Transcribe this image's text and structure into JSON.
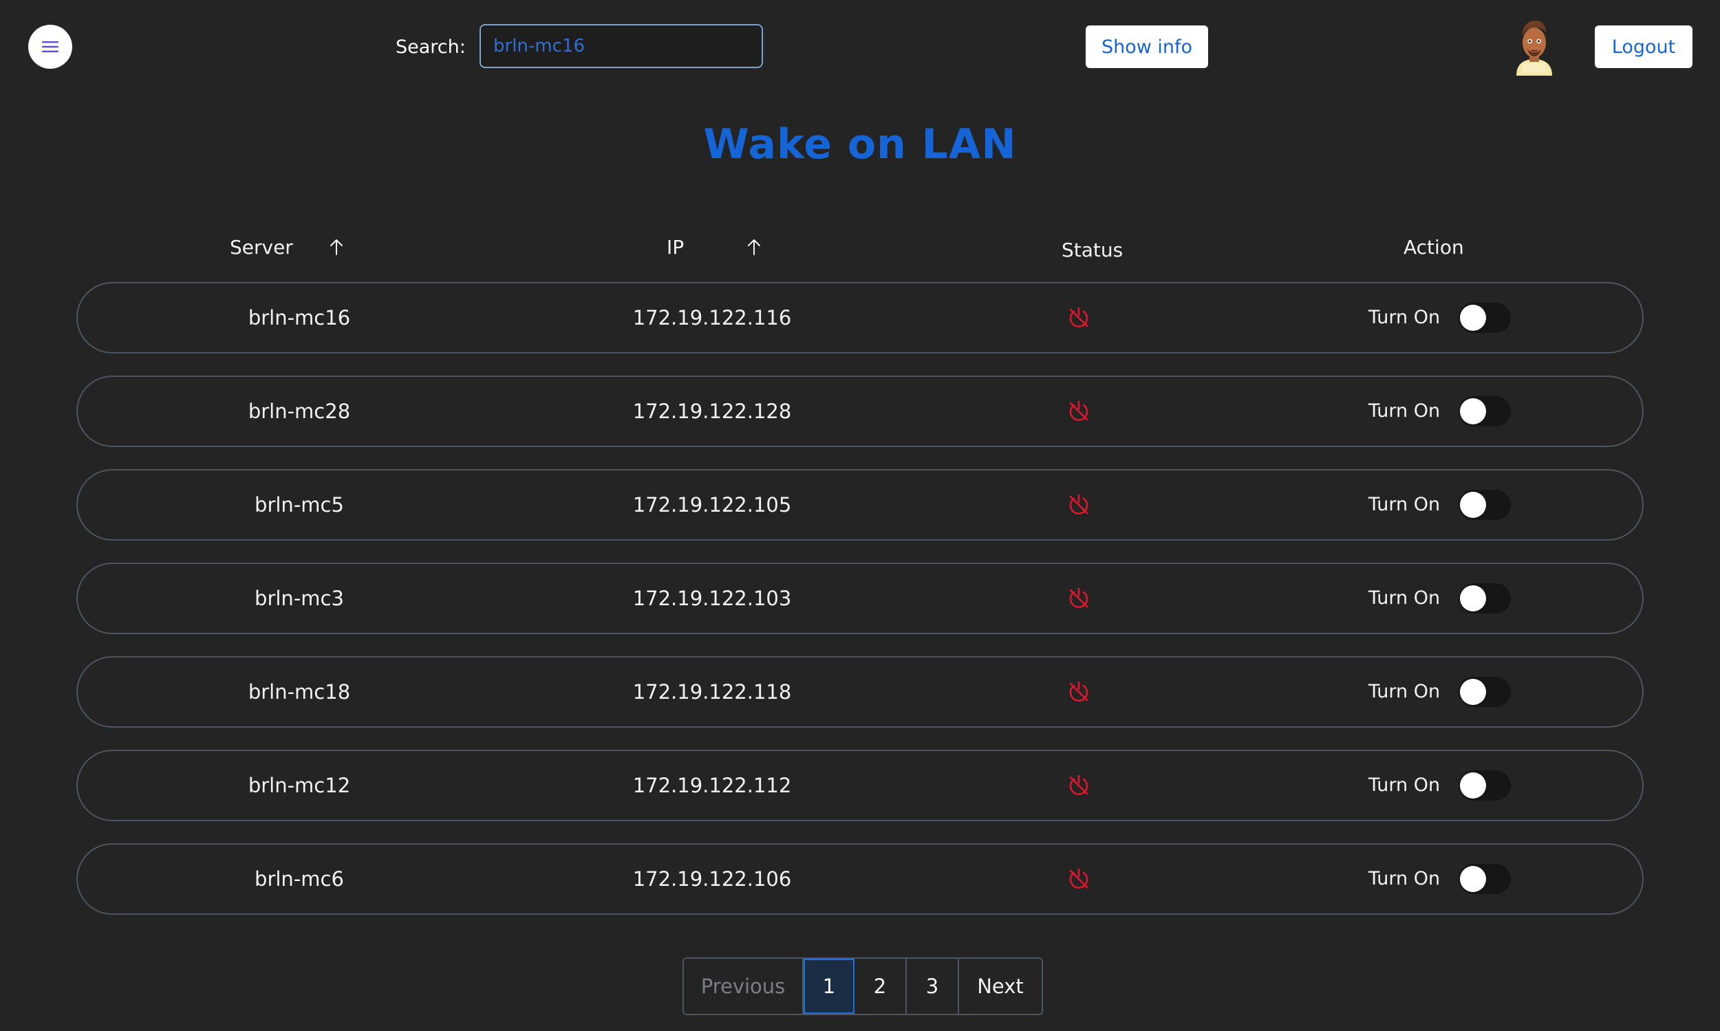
{
  "header": {
    "search_label": "Search:",
    "search_placeholder": "brln-mc16",
    "show_info_label": "Show info",
    "logout_label": "Logout",
    "menu_icon": "hamburger-menu-icon",
    "avatar_icon": "user-avatar"
  },
  "page": {
    "title": "Wake on LAN"
  },
  "table": {
    "columns": {
      "server": "Server",
      "ip": "IP",
      "status": "Status",
      "action": "Action"
    },
    "sort_icon": "arrow-up-icon",
    "status_icon": "power-off-icon",
    "status_color": "#e0162e",
    "rows": [
      {
        "server": "brln-mc16",
        "ip": "172.19.122.116",
        "action": "Turn On",
        "on": false
      },
      {
        "server": "brln-mc28",
        "ip": "172.19.122.128",
        "action": "Turn On",
        "on": false
      },
      {
        "server": "brln-mc5",
        "ip": "172.19.122.105",
        "action": "Turn On",
        "on": false
      },
      {
        "server": "brln-mc3",
        "ip": "172.19.122.103",
        "action": "Turn On",
        "on": false
      },
      {
        "server": "brln-mc18",
        "ip": "172.19.122.118",
        "action": "Turn On",
        "on": false
      },
      {
        "server": "brln-mc12",
        "ip": "172.19.122.112",
        "action": "Turn On",
        "on": false
      },
      {
        "server": "brln-mc6",
        "ip": "172.19.122.106",
        "action": "Turn On",
        "on": false
      }
    ]
  },
  "pagination": {
    "previous": "Previous",
    "pages": [
      "1",
      "2",
      "3"
    ],
    "current": "1",
    "next": "Next"
  },
  "colors": {
    "accent": "#1565d8",
    "background": "#242424",
    "row_border": "#4d5560"
  }
}
